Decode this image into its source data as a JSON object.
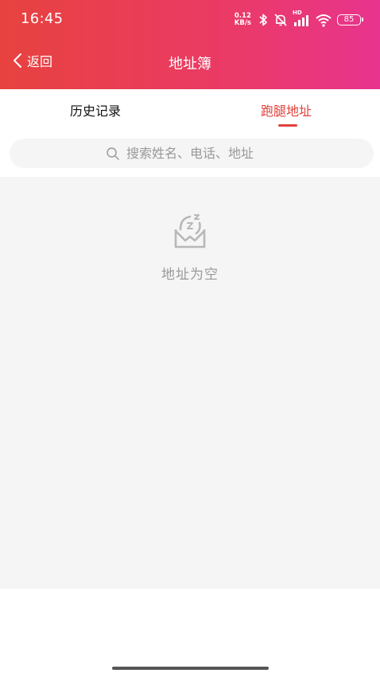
{
  "status_bar": {
    "time": "16:45",
    "net_speed_value": "0.12",
    "net_speed_unit": "KB/s",
    "signal_label": "HD",
    "battery_level": "85",
    "icons": [
      "bluetooth-icon",
      "mute-bell-icon",
      "signal-icon",
      "wifi-icon",
      "battery-icon"
    ]
  },
  "nav": {
    "back_label": "返回",
    "title": "地址簿"
  },
  "tabs": [
    {
      "label": "历史记录",
      "active": false
    },
    {
      "label": "跑腿地址",
      "active": true
    }
  ],
  "search": {
    "placeholder": "搜索姓名、电话、地址"
  },
  "empty_state": {
    "icon": "empty-mailbox-sleep-icon",
    "message": "地址为空"
  },
  "colors": {
    "header_gradient_start": "#e8423f",
    "header_gradient_end": "#e8348e",
    "accent": "#e0413a",
    "content_bg": "#f5f5f5"
  }
}
